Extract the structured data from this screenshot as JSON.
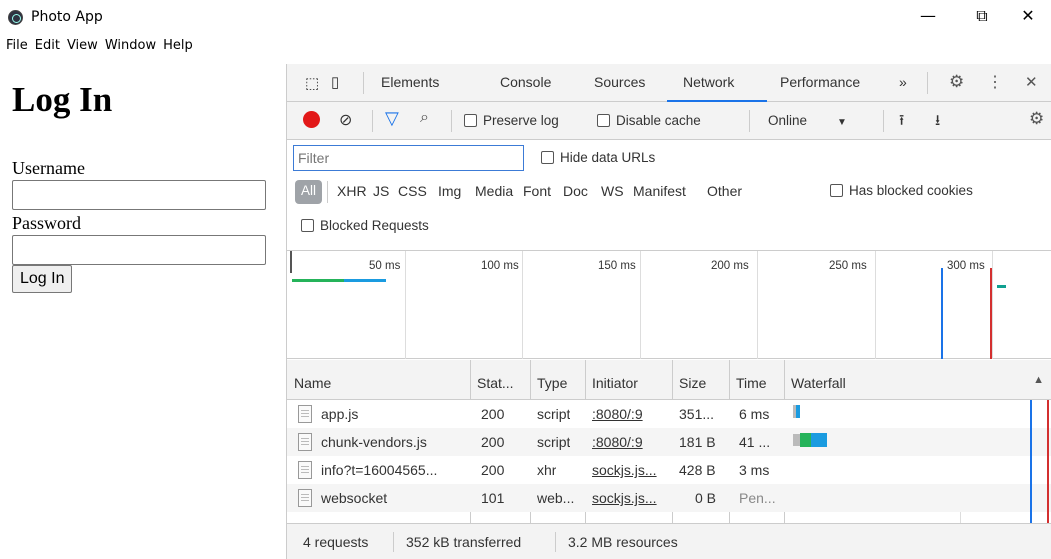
{
  "window": {
    "title": "Photo App",
    "controls": {
      "minimize": "—",
      "maximize": "⧉",
      "close": "✕"
    }
  },
  "menu": [
    "File",
    "Edit",
    "View",
    "Window",
    "Help"
  ],
  "login": {
    "heading": "Log In",
    "username_label": "Username",
    "username_value": "",
    "password_label": "Password",
    "password_value": "",
    "submit_label": "Log In"
  },
  "devtools": {
    "tabs": [
      "Elements",
      "Console",
      "Sources",
      "Network",
      "Performance"
    ],
    "active_tab": "Network",
    "more_tabs": "»",
    "toolbar": {
      "preserve_log": "Preserve log",
      "disable_cache": "Disable cache",
      "throttling": "Online"
    },
    "filter": {
      "placeholder": "Filter",
      "hide_data_urls": "Hide data URLs",
      "types": [
        "All",
        "XHR",
        "JS",
        "CSS",
        "Img",
        "Media",
        "Font",
        "Doc",
        "WS",
        "Manifest",
        "Other"
      ],
      "has_blocked_cookies": "Has blocked cookies",
      "blocked_requests": "Blocked Requests"
    },
    "overview": {
      "ticks": [
        "50 ms",
        "100 ms",
        "150 ms",
        "200 ms",
        "250 ms",
        "300 ms"
      ]
    },
    "table": {
      "headers": [
        "Name",
        "Stat...",
        "Type",
        "Initiator",
        "Size",
        "Time",
        "Waterfall"
      ],
      "rows": [
        {
          "name": "app.js",
          "status": "200",
          "type": "script",
          "initiator": ":8080/:9",
          "size": "351...",
          "time": "6 ms"
        },
        {
          "name": "chunk-vendors.js",
          "status": "200",
          "type": "script",
          "initiator": ":8080/:9",
          "size": "181 B",
          "time": "41 ..."
        },
        {
          "name": "info?t=16004565...",
          "status": "200",
          "type": "xhr",
          "initiator": "sockjs.js...",
          "size": "428 B",
          "time": "3 ms"
        },
        {
          "name": "websocket",
          "status": "101",
          "type": "web...",
          "initiator": "sockjs.js...",
          "size": "0 B",
          "time": "Pen..."
        }
      ]
    },
    "status": {
      "requests": "4 requests",
      "transferred": "352 kB transferred",
      "resources": "3.2 MB resources"
    }
  },
  "colors": {
    "accent": "#1a73e8",
    "record": "#e21818",
    "dom_line": "#1a73e8",
    "load_line": "#d32f2f"
  }
}
